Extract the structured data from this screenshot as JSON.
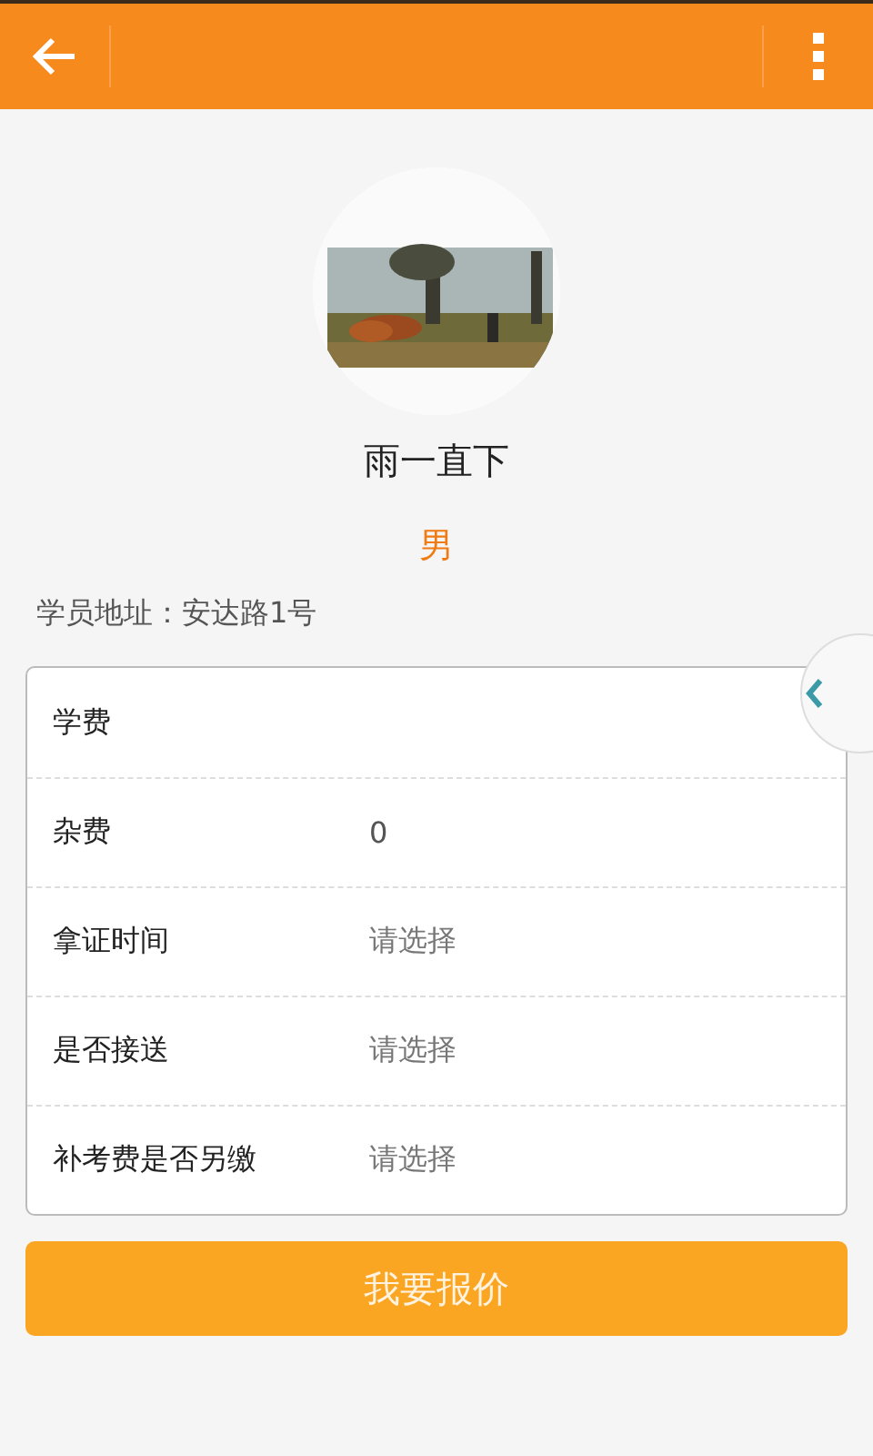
{
  "profile": {
    "name": "雨一直下",
    "gender": "男",
    "address": "学员地址：安达路1号"
  },
  "form": [
    {
      "label": "学费"
    },
    {
      "label": "杂费",
      "value": "0"
    },
    {
      "label": "拿证时间",
      "placeholder": "请选择"
    },
    {
      "label": "是否接送",
      "placeholder": "请选择"
    },
    {
      "label": "补考费是否另缴",
      "placeholder": "请选择"
    }
  ],
  "submit_button": "我要报价"
}
